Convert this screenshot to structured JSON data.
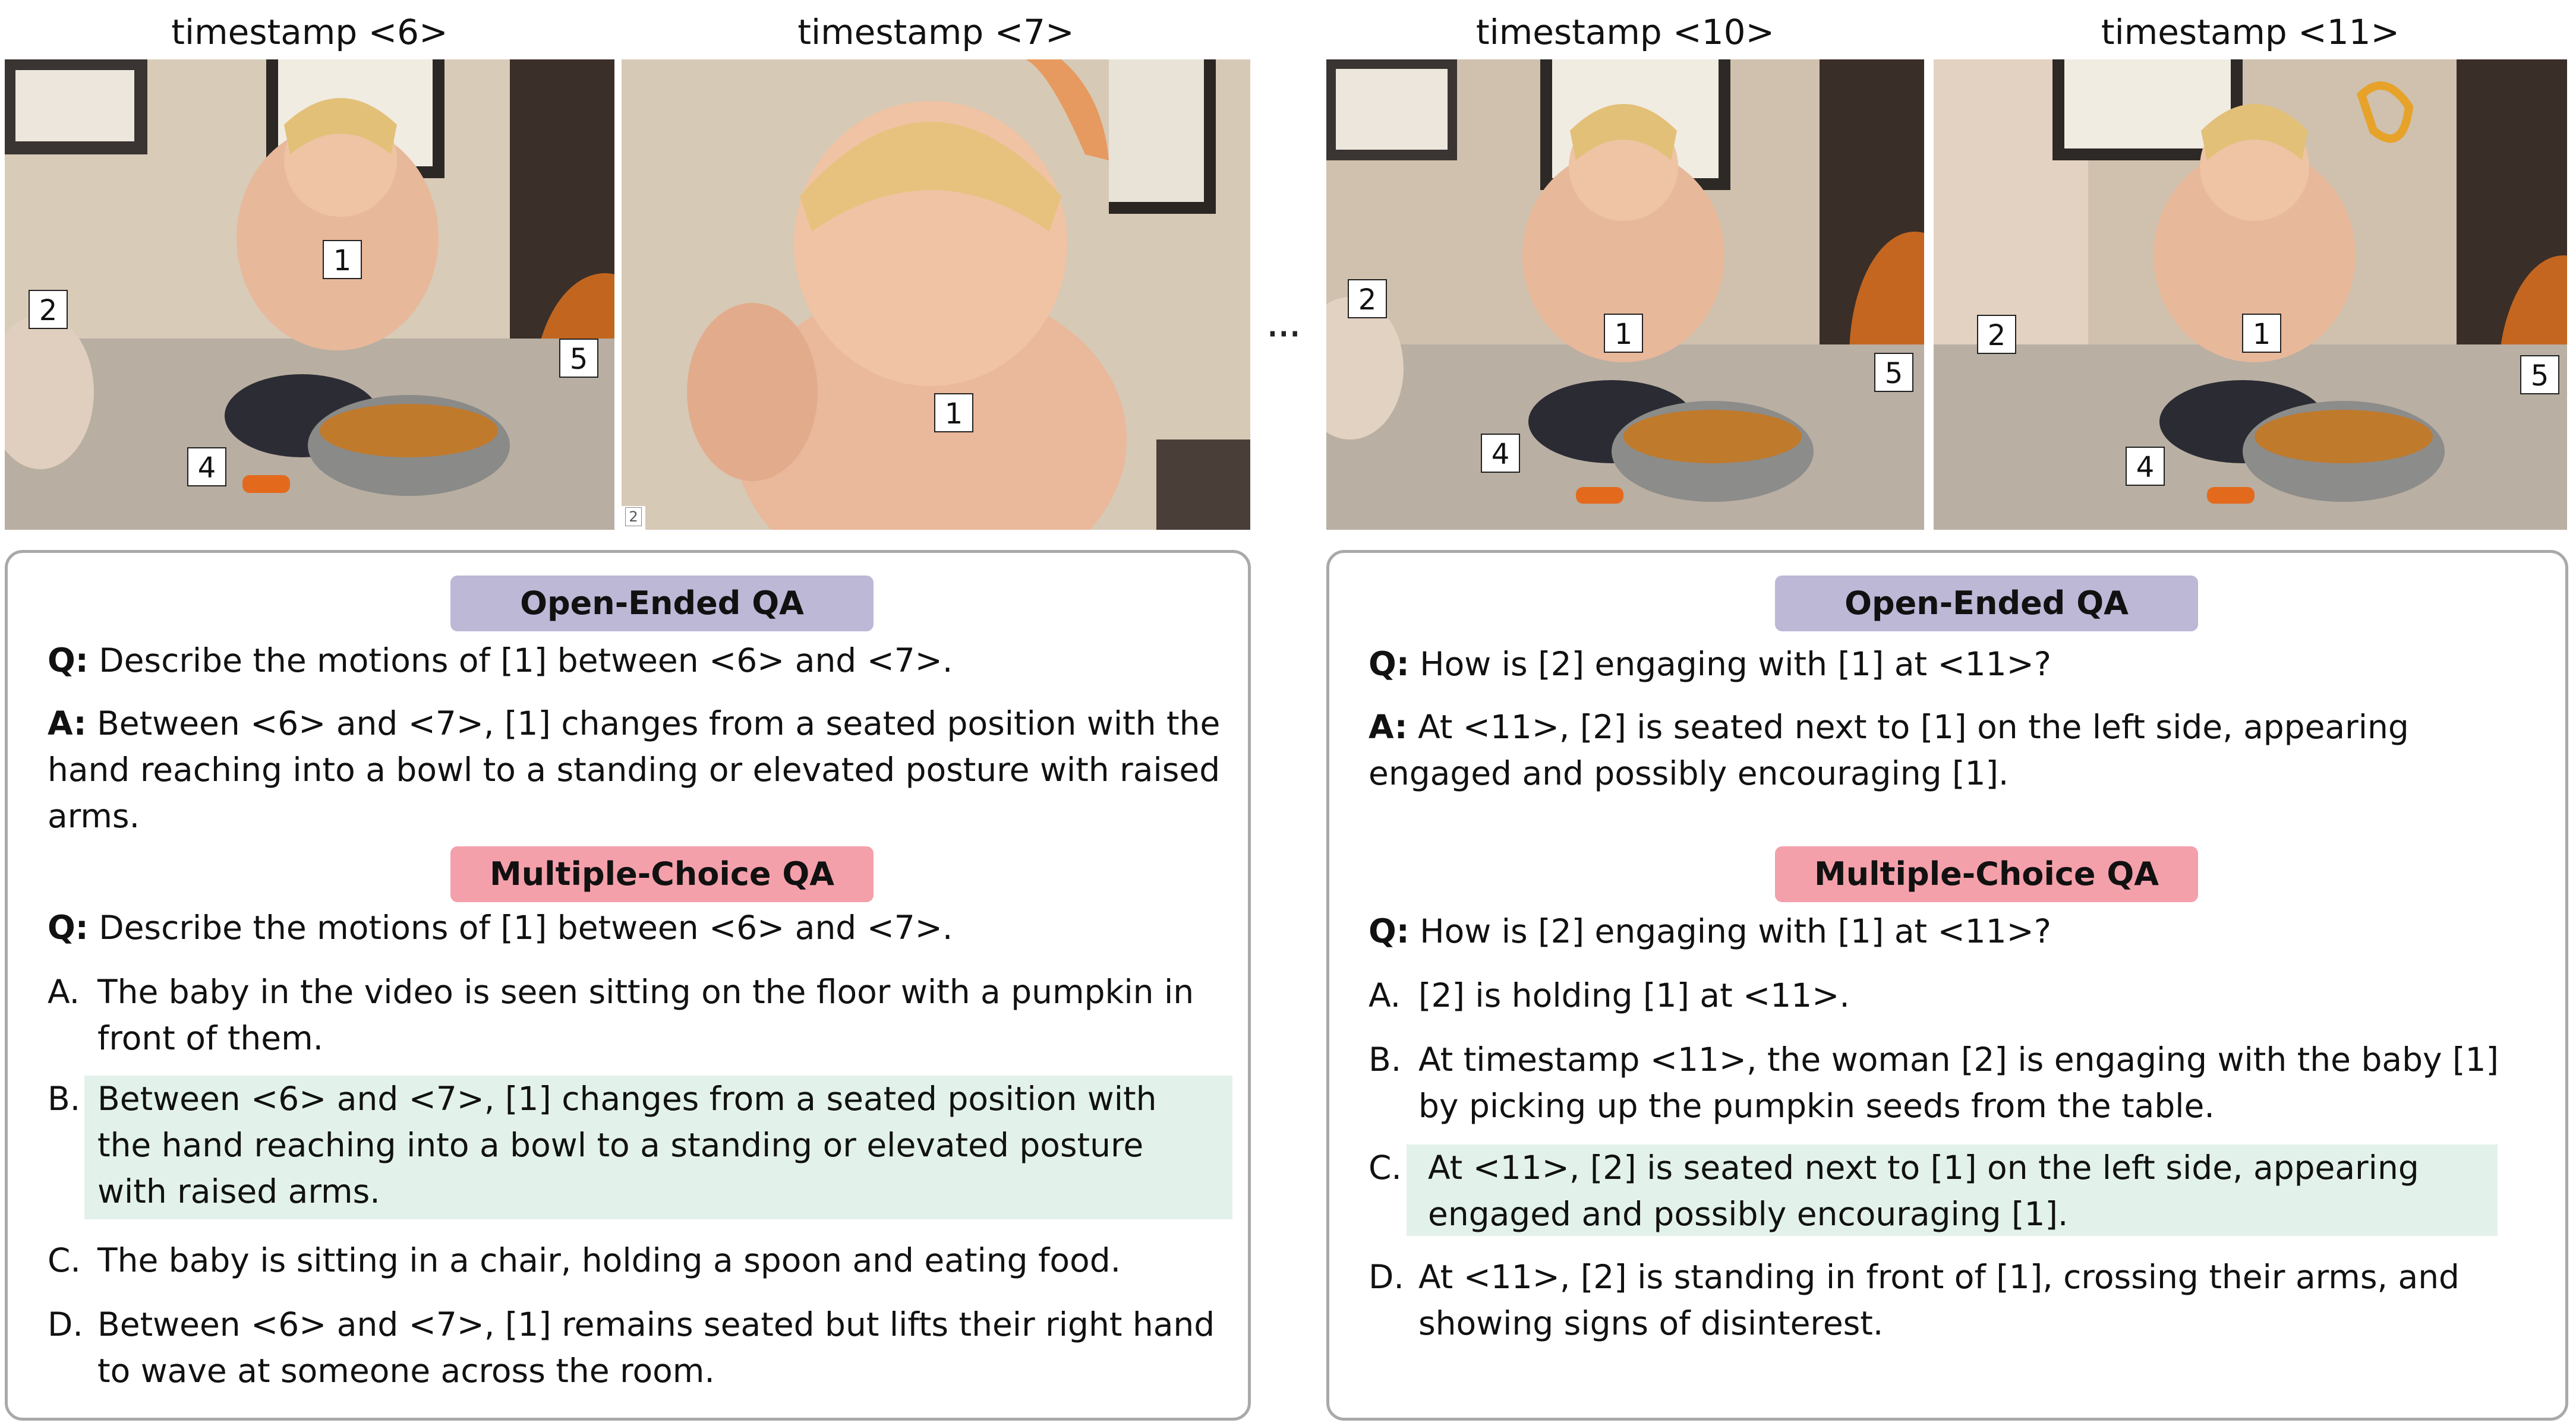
{
  "timestamps": [
    "timestamp <6>",
    "timestamp <7>",
    "timestamp <10>",
    "timestamp <11>"
  ],
  "ellipsis": "···",
  "frames": [
    {
      "tags": [
        "1",
        "2",
        "4",
        "5"
      ]
    },
    {
      "tags": [
        "1"
      ],
      "corner": "2"
    },
    {
      "tags": [
        "2",
        "1",
        "4",
        "5"
      ]
    },
    {
      "tags": [
        "2",
        "1",
        "4",
        "5"
      ]
    }
  ],
  "left_panel": {
    "open_header": "Open-Ended QA",
    "q_label": "Q:",
    "q_text": " Describe the motions of [1] between <6> and <7>.",
    "a_label": "A:",
    "a_lines": [
      " Between <6> and <7>, [1] changes from a seated position with the",
      "hand reaching into a bowl to a standing or elevated posture with raised",
      "arms."
    ],
    "mc_header": "Multiple-Choice QA",
    "mc_q_text": " Describe the motions of [1] between <6> and <7>.",
    "options": [
      {
        "letter": "A.",
        "lines": [
          "The baby in the video is seen sitting on the floor with a pumpkin in",
          "front of them."
        ]
      },
      {
        "letter": "B.",
        "lines": [
          "Between <6> and <7>, [1] changes from a seated position with",
          "the  hand reaching into a bowl to a standing or elevated posture",
          "with raised arms."
        ],
        "correct": true
      },
      {
        "letter": "C.",
        "lines": [
          "The baby is sitting in a chair, holding a spoon and eating food."
        ]
      },
      {
        "letter": "D.",
        "lines": [
          "Between <6> and <7>, [1] remains seated but lifts their right hand",
          "to wave at someone across the room."
        ]
      }
    ]
  },
  "right_panel": {
    "open_header": "Open-Ended QA",
    "q_label": "Q:",
    "q_text": " How is [2] engaging with [1] at <11>?",
    "a_label": "A:",
    "a_lines": [
      " At <11>, [2] is seated next to [1] on the left side, appearing",
      "engaged and possibly encouraging [1]."
    ],
    "mc_header": "Multiple-Choice QA",
    "mc_q_text": " How is [2] engaging with [1] at <11>?",
    "options": [
      {
        "letter": "A.",
        "lines": [
          "[2] is holding [1] at <11>."
        ]
      },
      {
        "letter": "B.",
        "lines": [
          "At timestamp <11>, the woman [2] is engaging with the baby [1]",
          "by picking up the pumpkin seeds from the table."
        ]
      },
      {
        "letter": "C.",
        "lines": [
          "At <11>, [2] is seated next to [1] on the left side, appearing",
          "engaged and possibly encouraging [1]."
        ],
        "correct": true
      },
      {
        "letter": "D.",
        "lines": [
          "At <11>, [2] is standing in front of [1], crossing their arms, and",
          "showing signs of disinterest."
        ]
      }
    ]
  },
  "colors": {
    "open_header": "#bcb8d6",
    "mc_header": "#f4a0ab",
    "correct_highlight": "#e2f2ea",
    "panel_border": "#a9a9a9"
  }
}
